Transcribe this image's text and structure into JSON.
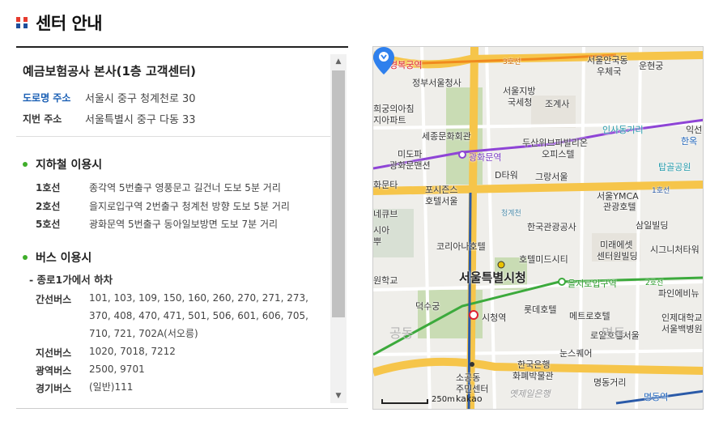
{
  "header": {
    "title": "센터 안내"
  },
  "panel": {
    "title": "예금보험공사 본사(1층 고객센터)",
    "road_address": {
      "label": "도로명 주소",
      "value": "서울시 중구 청계천로 30"
    },
    "lot_address": {
      "label": "지번 주소",
      "value": "서울특별시 중구 다동 33"
    },
    "subway": {
      "title": "지하철 이용시",
      "lines": [
        {
          "label": "1호선",
          "value": "종각역 5번출구 영풍문고 길건너 도보 5분 거리"
        },
        {
          "label": "2호선",
          "value": "을지로입구역 2번출구 청계천 방향 도보 5분 거리"
        },
        {
          "label": "5호선",
          "value": "광화문역 5번출구 동아일보방면 도보 7분 거리"
        }
      ]
    },
    "bus": {
      "title": "버스 이용시",
      "subtitle": "- 종로1가에서 하차",
      "rows": [
        {
          "label": "간선버스",
          "value": "101, 103, 109, 150, 160, 260, 270, 271, 273, 370, 408, 470, 471, 501, 506, 601, 606, 705, 710, 721, 702A(서오릉)"
        },
        {
          "label": "지선버스",
          "value": "1020, 7018, 7212"
        },
        {
          "label": "광역버스",
          "value": "2500, 9701"
        },
        {
          "label": "경기버스",
          "value": "(일반)111"
        }
      ]
    },
    "scroll": {
      "up_icon": "▲",
      "down_icon": "▼"
    }
  },
  "map": {
    "labels": {
      "gyeongbokgung": "경복궁역",
      "line3": "3호선",
      "jeongbu": "정부서울청사",
      "anguk": "서울안국동",
      "anguk2": "우체국",
      "unhyeon": "운현궁",
      "jihwai": "희궁의아침",
      "jihwai2": "지아파트",
      "jibang": "서울지방",
      "jibang2": "국세청",
      "jogyesa": "조계사",
      "insadong": "인사동거리",
      "iksun": "익선",
      "hanok": "한옥",
      "sejong": "세종문화회관",
      "dosan": "두산위브파빌리온",
      "dosan2": "오피스텔",
      "mido": "미도파",
      "mido2": "광화문맨션",
      "gwanghwamun": "광화문역",
      "tapgol": "탑골공원",
      "dtower": "D타워",
      "gran": "그랑서울",
      "hwamun": "화문타",
      "posijeuns": "포시즌스",
      "posijeuns2": "호텔서울",
      "ymca": "서울YMCA",
      "ymca2": "관광호텔",
      "line1": "1호선",
      "cheonggye": "청계천",
      "hanguk": "한국관광공사",
      "samil": "삼일빌딩",
      "nekyub": "네큐브",
      "siah": "시아",
      "ppu": "뿌",
      "korea": "코리아나호텔",
      "miraeasset": "미래에셋",
      "miraeasset2": "센터원빌딩",
      "sigeu": "시그니처타워",
      "middle": "호텔미드시티",
      "cityhall": "서울특별시청",
      "euljiro": "을지로입구역",
      "line2": "2호선",
      "paiman": "파인에비뉴",
      "hakgyo": "원학교",
      "deoksu": "덕수궁",
      "lotte": "롯데호텔",
      "metro": "메트로호텔",
      "incheon": "인제대학교",
      "paik": "서울백병원",
      "sicheong": "시청역",
      "royal": "로얄호텔서울",
      "noon": "눈스퀘어",
      "bank": "한국은행",
      "bank2": "화폐박물관",
      "sogong": "소공동",
      "sogong2": "주민센터",
      "myeongdong": "명동거리",
      "myeongdong_st": "명동역",
      "jeil": "옛제일은행",
      "gongdong": "공동",
      "myeongdong_ghost": "명동"
    },
    "scale_label": "250m",
    "brand": "kakao",
    "colors": {
      "line1": "#2a5aa8",
      "line2": "#3caa3c",
      "line3": "#f08a1e",
      "line5": "#8e44d6",
      "road": "#f6c54a",
      "park": "#c9dcb4",
      "pin": "#2f80ed"
    }
  }
}
